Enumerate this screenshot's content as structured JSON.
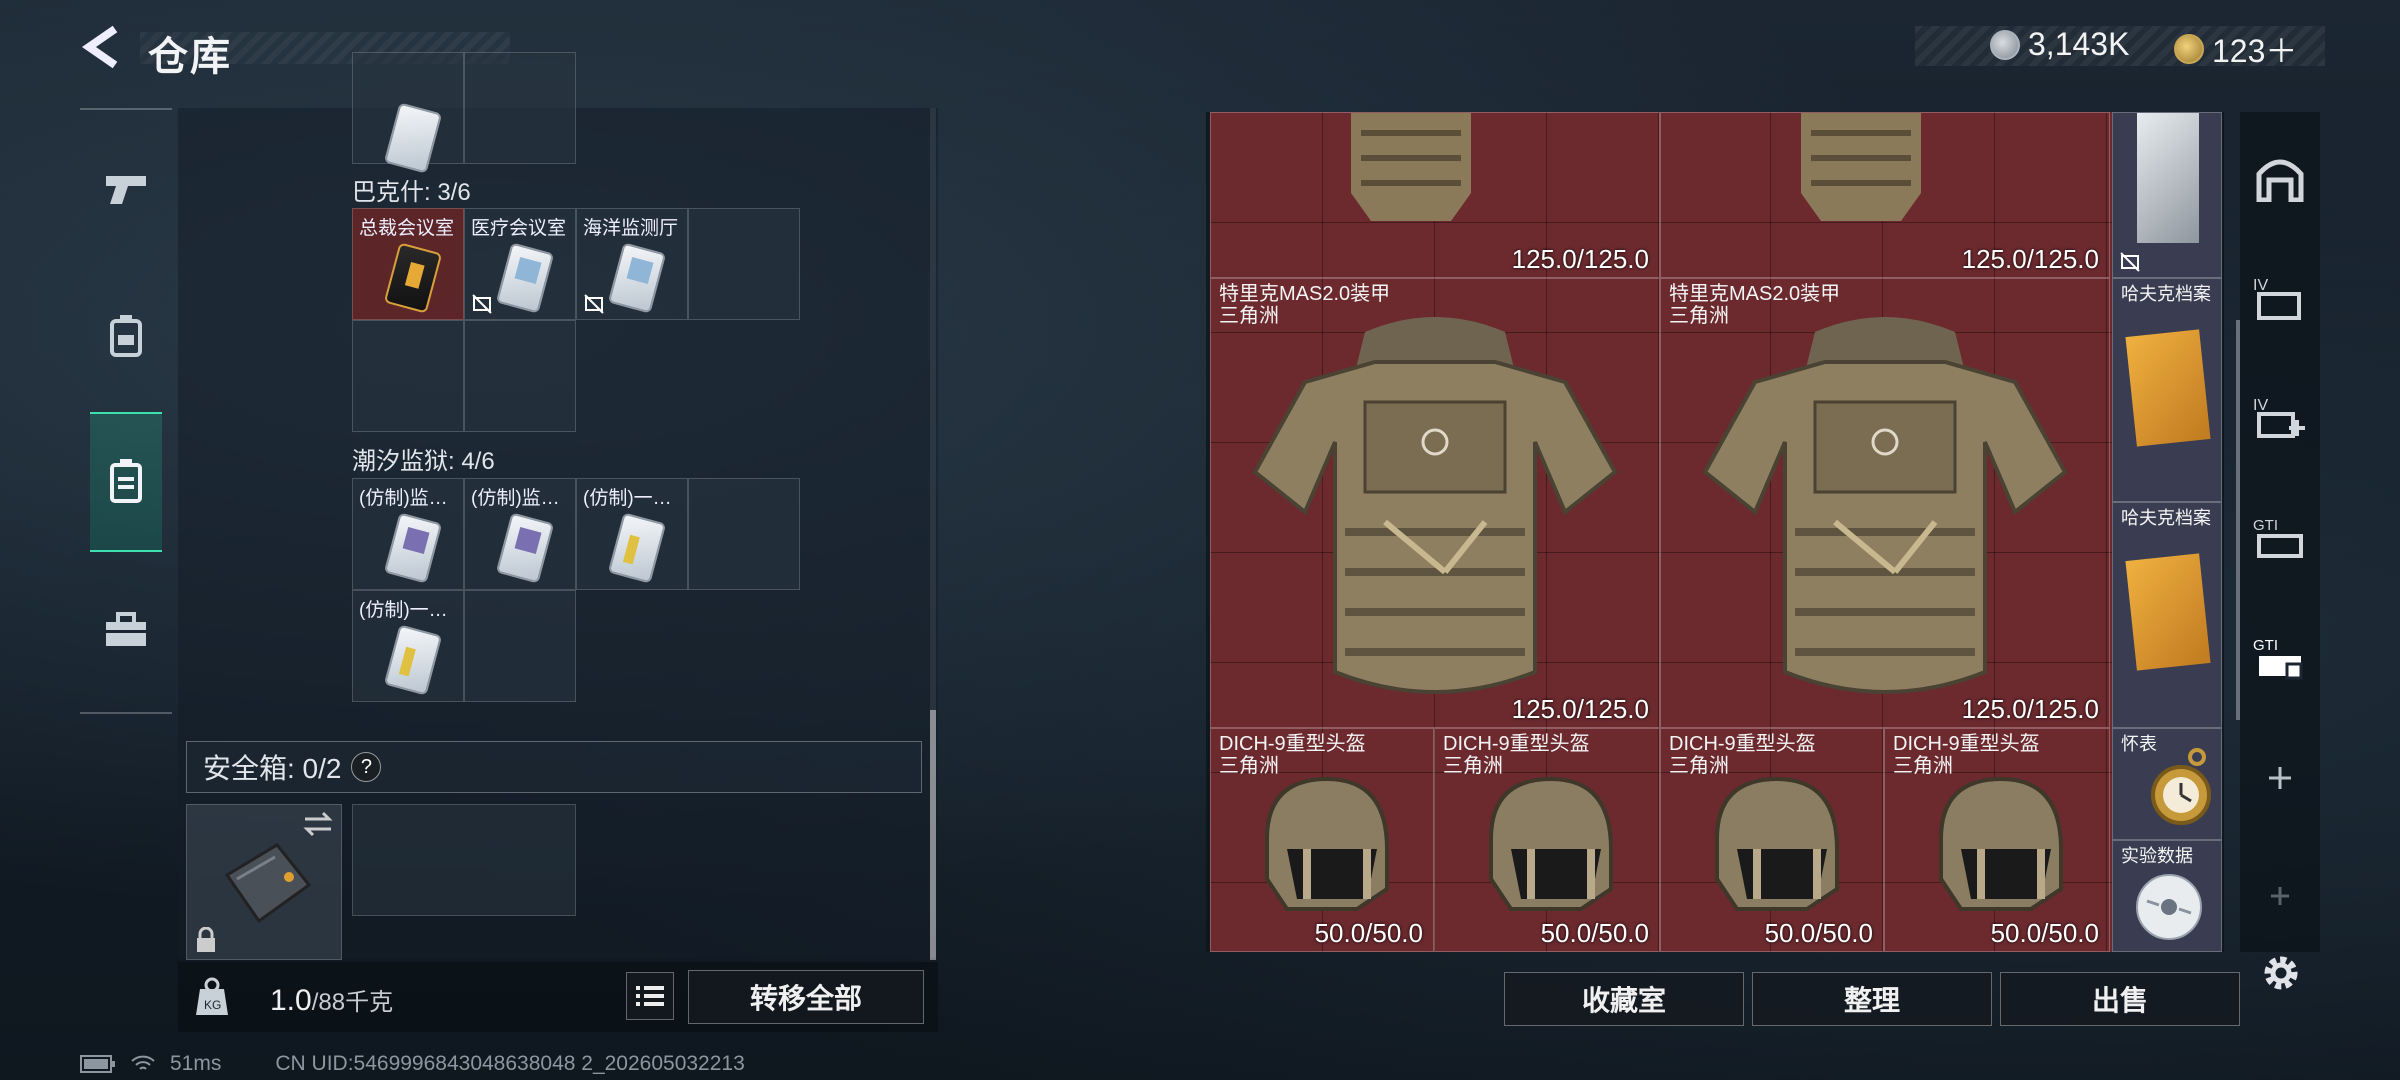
{
  "header": {
    "title": "仓库",
    "currency_coins": "3,143K",
    "currency_gold": "123＋"
  },
  "stash": {
    "section_bakshi": "巴克什: 3/6",
    "bakshi_cards": [
      "总裁会议室",
      "医疗会议室",
      "海洋监测厅"
    ],
    "section_prison": "潮汐监狱: 4/6",
    "prison_cards": [
      "(仿制)监…",
      "(仿制)监…",
      "(仿制)一…",
      "(仿制)一…"
    ],
    "safebox_label": "安全箱:  0/2",
    "help": "?"
  },
  "footer": {
    "weight_value": "1.0",
    "weight_capacity": "/88千克",
    "transfer_all": "转移全部",
    "status_ping": "51ms",
    "uid": "CN UID:5469996843048638048 2_202605032213"
  },
  "inventory": {
    "armor_top_left_dur": "125.0/125.0",
    "armor_top_right_dur": "125.0/125.0",
    "armors": [
      {
        "name": "特里克MAS2.0装甲",
        "sub": "三角洲",
        "dur": "125.0/125.0"
      },
      {
        "name": "特里克MAS2.0装甲",
        "sub": "三角洲",
        "dur": "125.0/125.0"
      }
    ],
    "helmets": [
      {
        "name": "DICH-9重型头盔",
        "sub": "三角洲",
        "dur": "50.0/50.0"
      },
      {
        "name": "DICH-9重型头盔",
        "sub": "三角洲",
        "dur": "50.0/50.0"
      },
      {
        "name": "DICH-9重型头盔",
        "sub": "三角洲",
        "dur": "50.0/50.0"
      },
      {
        "name": "DICH-9重型头盔",
        "sub": "三角洲",
        "dur": "50.0/50.0"
      }
    ],
    "side_items": [
      "哈夫克档案",
      "哈夫克档案",
      "怀表",
      "实验数据"
    ],
    "buttons": {
      "collection": "收藏室",
      "organize": "整理",
      "sell": "出售"
    }
  },
  "colors": {
    "accent": "#3fe0b0",
    "grid_red": "#6c2a2f"
  }
}
